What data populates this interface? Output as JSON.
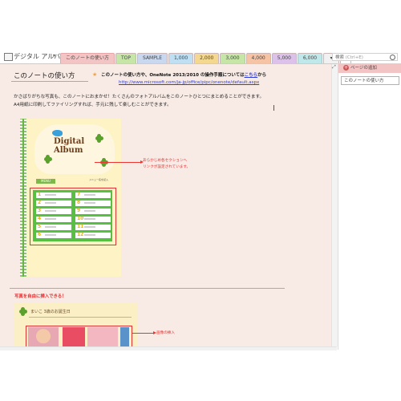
{
  "notebook": {
    "title": "デジタル アルバム",
    "dropdown_glyph": "▾"
  },
  "tabs": [
    {
      "label": "このノートの使い方",
      "color": "#f3c4c4",
      "active": true
    },
    {
      "label": "TOP",
      "color": "#c6e6a8"
    },
    {
      "label": "SAMPLE",
      "color": "#c9d8ef"
    },
    {
      "label": "1,000",
      "color": "#bfe0f2"
    },
    {
      "label": "2,000",
      "color": "#f5d890"
    },
    {
      "label": "3,000",
      "color": "#c6e6a8"
    },
    {
      "label": "4,000",
      "color": "#f6c4a4"
    },
    {
      "label": "5,000",
      "color": "#dcc2ea"
    },
    {
      "label": "6,000",
      "color": "#bfe8ea"
    }
  ],
  "tab_more": "▾",
  "tab_add": "+",
  "search": {
    "label": "検索",
    "placeholder": "(Ctrl+E)"
  },
  "page": {
    "title": "このノートの使い方",
    "note_prefix": "このノートの使い方や、OneNote 2013/2010 の操作手順については",
    "note_link": "こちら",
    "note_suffix": "から",
    "url": "http://www.microsoft.com/ja-jp/office/pipc/onenote/default.aspx",
    "body_lines": [
      "かさばりがちな写真も、このノートにおまかせ！たくさんのフォトアルバムをこのノートひとつにまとめることができます。",
      "A4用紙に印刷してファイリングすれば、手元に残して楽しむことができます。"
    ],
    "album_title_1": "Digital",
    "album_title_2": "Album",
    "menu_label": "MENU",
    "menu_sub": "メニュー名を記入",
    "menu_numbers": [
      "1",
      "7",
      "2",
      "8",
      "3",
      "9",
      "4",
      "10",
      "5",
      "11",
      "6",
      "12"
    ],
    "callout1_lines": [
      "あらかじめ各セクションへ",
      "リンクが設定されています。"
    ],
    "section2_heading": "写真を自由に挿入できる！",
    "section2_image_title": "まいこ 3歳のお誕生日",
    "callout2": "画像の挿入"
  },
  "sidebar": {
    "add_page": "ページの追加",
    "pages": [
      "このノートの使い方"
    ]
  },
  "accent": "#e23030"
}
